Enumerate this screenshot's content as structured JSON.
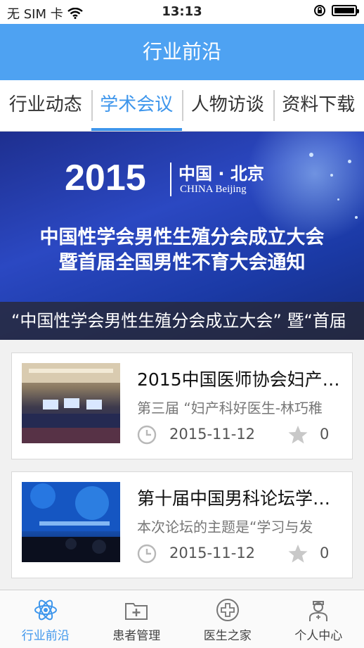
{
  "status_bar": {
    "carrier": "无 SIM 卡",
    "time": "13:13"
  },
  "nav": {
    "title": "行业前沿"
  },
  "tabs": [
    {
      "label": "行业动态",
      "active": false
    },
    {
      "label": "学术会议",
      "active": true
    },
    {
      "label": "人物访谈",
      "active": false
    },
    {
      "label": "资料下载",
      "active": false
    }
  ],
  "banner": {
    "year": "2015",
    "city_cn": "中国 · 北京",
    "city_en": "CHINA   Beijing",
    "headline_line1": "中国性学会男性生殖分会成立大会",
    "headline_line2": "暨首届全国男性不育大会通知",
    "caption": "“中国性学会男性生殖分会成立大会” 暨“首届"
  },
  "articles": [
    {
      "title": "2015中国医师协会妇产…",
      "summary": "第三届 “妇产科好医生-林巧稚",
      "date": "2015-11-12",
      "likes": "0"
    },
    {
      "title": "第十届中国男科论坛学…",
      "summary": "本次论坛的主题是“学习与发",
      "date": "2015-11-12",
      "likes": "0"
    }
  ],
  "bottom_tabs": [
    {
      "label": "行业前沿",
      "icon": "atom-icon",
      "active": true
    },
    {
      "label": "患者管理",
      "icon": "medical-folder-icon",
      "active": false
    },
    {
      "label": "医生之家",
      "icon": "medical-cross-icon",
      "active": false
    },
    {
      "label": "个人中心",
      "icon": "doctor-avatar-icon",
      "active": false
    }
  ],
  "colors": {
    "accent": "#3e96ec",
    "nav_bg": "#4ea2f2",
    "banner_bg": "#2b48c2"
  }
}
